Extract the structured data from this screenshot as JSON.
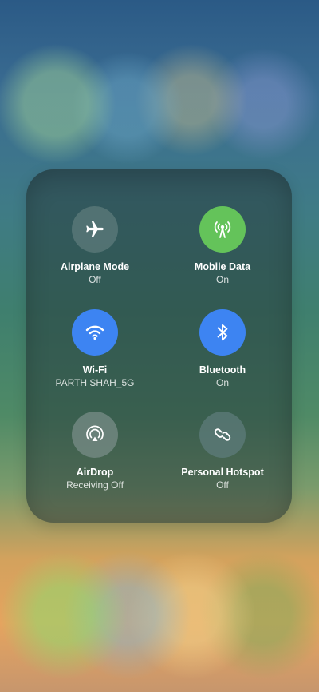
{
  "control_center": {
    "tiles": [
      {
        "title": "Airplane Mode",
        "subtitle": "Off",
        "icon": "airplane-icon"
      },
      {
        "title": "Mobile Data",
        "subtitle": "On",
        "icon": "antenna-icon"
      },
      {
        "title": "Wi-Fi",
        "subtitle": "PARTH SHAH_5G",
        "icon": "wifi-icon"
      },
      {
        "title": "Bluetooth",
        "subtitle": "On",
        "icon": "bluetooth-icon"
      },
      {
        "title": "AirDrop",
        "subtitle": "Receiving Off",
        "icon": "airdrop-icon"
      },
      {
        "title": "Personal Hotspot",
        "subtitle": "Off",
        "icon": "hotspot-link-icon"
      }
    ]
  },
  "colors": {
    "active_green": "#64c35a",
    "active_blue": "#3d84f2",
    "inactive": "#5f7d7d"
  }
}
